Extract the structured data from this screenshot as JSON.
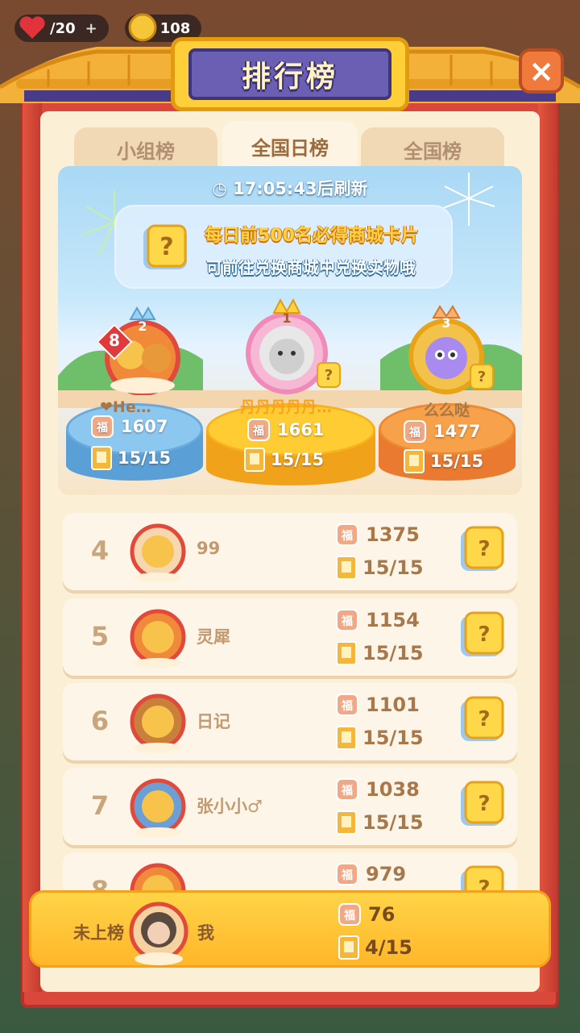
{
  "hud": {
    "lives": "/20",
    "coins": "108",
    "plus": "+"
  },
  "title": "排行榜",
  "close_label": "×",
  "tabs": [
    {
      "label": "小组榜",
      "active": false
    },
    {
      "label": "全国日榜",
      "active": true
    },
    {
      "label": "全国榜",
      "active": false
    }
  ],
  "refresh_text": "17:05:43后刷新",
  "banner": {
    "line1": "每日前500名必得商城卡片",
    "line2": "可前往兑换商城中兑换实物哦"
  },
  "podium": {
    "first": {
      "rank": "1",
      "name": "丹丹丹丹丹…",
      "score": "1661",
      "progress": "15/15"
    },
    "second": {
      "rank": "2",
      "name": "❤He…",
      "badge": "8",
      "score": "1607",
      "progress": "15/15"
    },
    "third": {
      "rank": "3",
      "name": "么么哒",
      "score": "1477",
      "progress": "15/15"
    }
  },
  "rows": [
    {
      "rank": "4",
      "name": "99",
      "score": "1375",
      "progress": "15/15"
    },
    {
      "rank": "5",
      "name": "灵犀",
      "score": "1154",
      "progress": "15/15"
    },
    {
      "rank": "6",
      "name": "日记",
      "score": "1101",
      "progress": "15/15"
    },
    {
      "rank": "7",
      "name": "张小小♂",
      "score": "1038",
      "progress": "15/15"
    },
    {
      "rank": "8",
      "name": "",
      "score": "979",
      "progress": ""
    }
  ],
  "me": {
    "rank_label": "未上榜",
    "name": "我",
    "score": "76",
    "progress": "4/15"
  },
  "colors": {
    "frame": "#d9483a",
    "panel": "#fbefd6",
    "accent": "#ffcf3a",
    "title_board": "#6a5fb2"
  }
}
